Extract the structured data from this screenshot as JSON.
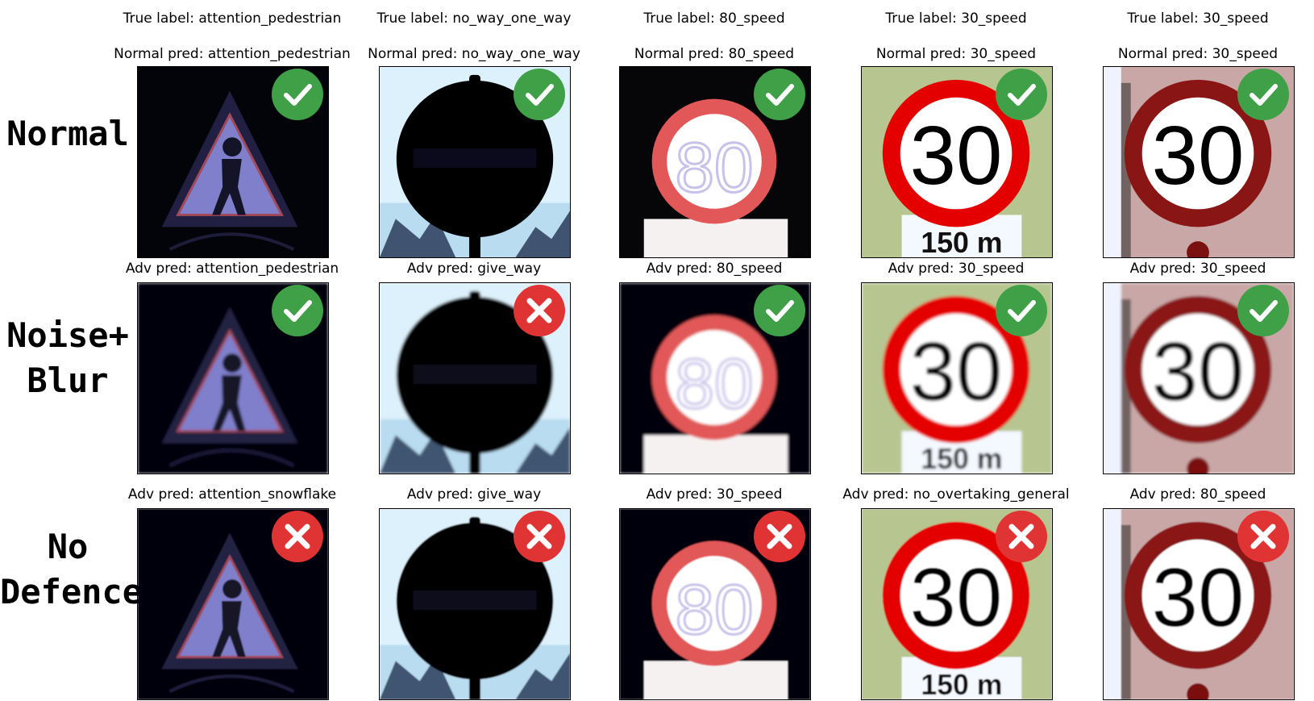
{
  "row_labels": [
    "Normal",
    "Noise+\nBlur",
    "No\nDefence"
  ],
  "columns": [
    {
      "true_label": "True label: attention_pedestrian",
      "normal_pred": "Normal pred: attention_pedestrian",
      "blur_pred": "Adv pred: attention_pedestrian",
      "nodef_pred": "Adv pred: attention_snowflake",
      "results": [
        "correct",
        "correct",
        "wrong"
      ],
      "sign": "pedestrian-warning-sign"
    },
    {
      "true_label": "True label: no_way_one_way",
      "normal_pred": "Normal pred: no_way_one_way",
      "blur_pred": "Adv pred: give_way",
      "nodef_pred": "Adv pred: give_way",
      "results": [
        "correct",
        "wrong",
        "wrong"
      ],
      "sign": "no-entry-sign"
    },
    {
      "true_label": "True label: 80_speed",
      "normal_pred": "Normal pred: 80_speed",
      "blur_pred": "Adv pred: 80_speed",
      "nodef_pred": "Adv pred: 30_speed",
      "results": [
        "correct",
        "correct",
        "wrong"
      ],
      "sign": "speed-limit-sign",
      "sign_text": "80"
    },
    {
      "true_label": "True label: 30_speed",
      "normal_pred": "Normal pred: 30_speed",
      "blur_pred": "Adv pred: 30_speed",
      "nodef_pred": "Adv pred: no_overtaking_general",
      "results": [
        "correct",
        "correct",
        "wrong"
      ],
      "sign": "speed-limit-sign",
      "sign_text": "30",
      "plate_text": "150 m"
    },
    {
      "true_label": "True label: 30_speed",
      "normal_pred": "Normal pred: 30_speed",
      "blur_pred": "Adv pred: 30_speed",
      "nodef_pred": "Adv pred: 80_speed",
      "results": [
        "correct",
        "correct",
        "wrong"
      ],
      "sign": "speed-limit-sign",
      "sign_text": "30"
    }
  ],
  "colors": {
    "correct": "#3fa047",
    "wrong": "#e03434"
  }
}
